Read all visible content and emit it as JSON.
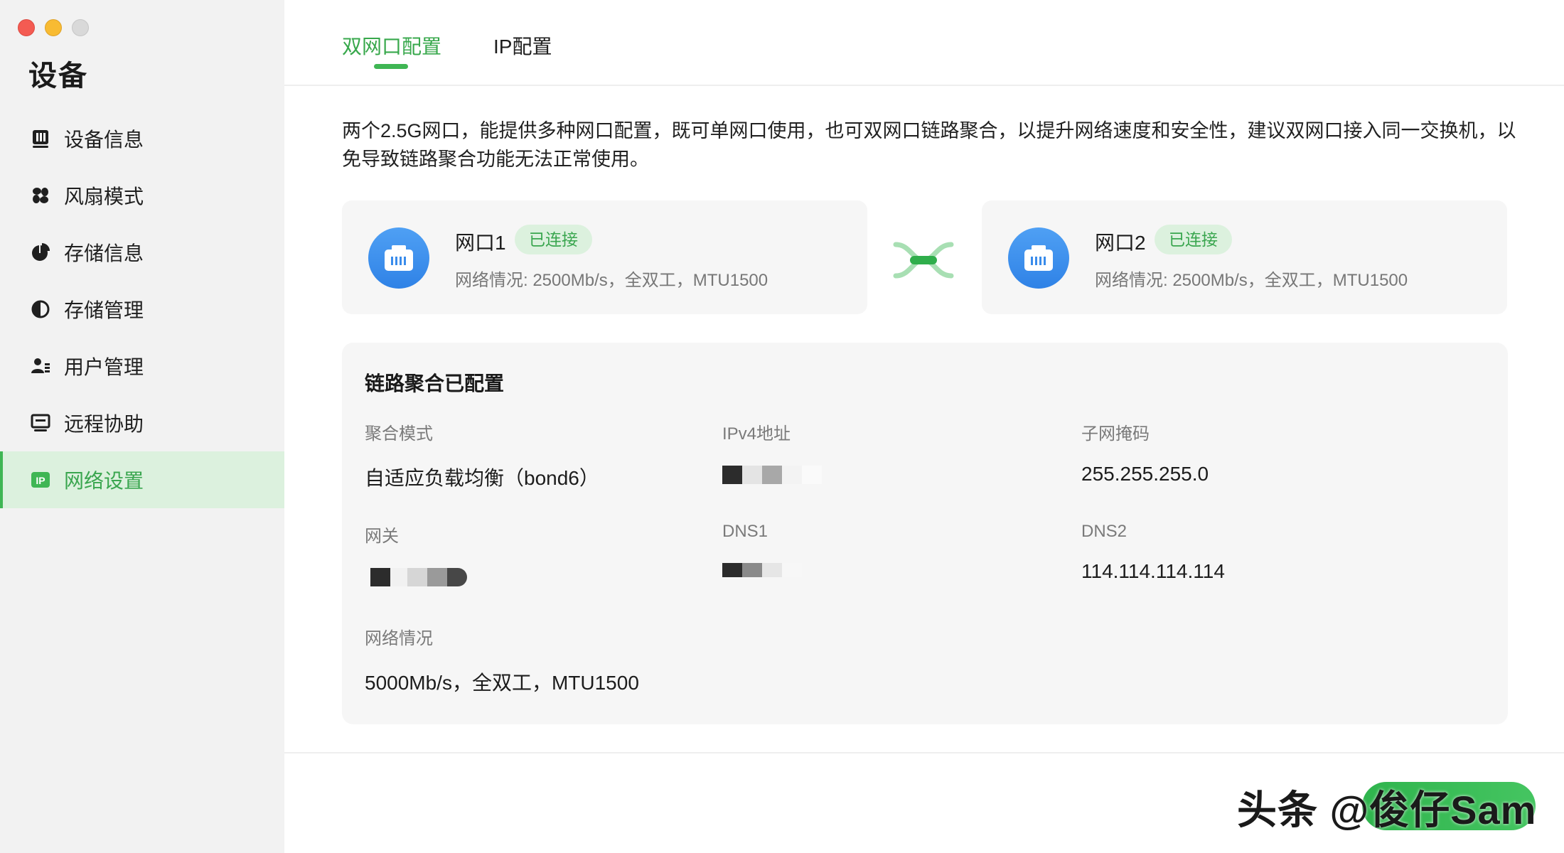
{
  "window": {
    "controls": [
      "close",
      "minimize",
      "zoom"
    ]
  },
  "sidebar": {
    "title": "设备",
    "items": [
      {
        "label": "设备信息",
        "icon": "device-info-icon"
      },
      {
        "label": "风扇模式",
        "icon": "fan-icon"
      },
      {
        "label": "存储信息",
        "icon": "storage-pie-icon"
      },
      {
        "label": "存储管理",
        "icon": "storage-manage-icon"
      },
      {
        "label": "用户管理",
        "icon": "users-icon"
      },
      {
        "label": "远程协助",
        "icon": "monitor-icon"
      },
      {
        "label": "网络设置",
        "icon": "ip-icon",
        "active": true
      }
    ]
  },
  "tabs": [
    {
      "label": "双网口配置",
      "active": true
    },
    {
      "label": "IP配置",
      "active": false
    }
  ],
  "intro": "两个2.5G网口，能提供多种网口配置，既可单网口使用，也可双网口链路聚合，以提升网络速度和安全性，建议双网口接入同一交换机，以免导致链路聚合功能无法正常使用。",
  "ports": [
    {
      "name": "网口1",
      "badge": "已连接",
      "status": "网络情况: 2500Mb/s，全双工，MTU1500"
    },
    {
      "name": "网口2",
      "badge": "已连接",
      "status": "网络情况: 2500Mb/s，全双工，MTU1500"
    }
  ],
  "aggregation": {
    "title": "链路聚合已配置",
    "fields": {
      "mode": {
        "label": "聚合模式",
        "value": "自适应负载均衡（bond6）"
      },
      "ipv4": {
        "label": "IPv4地址",
        "value": ""
      },
      "subnet": {
        "label": "子网掩码",
        "value": "255.255.255.0"
      },
      "gateway": {
        "label": "网关",
        "value": ""
      },
      "dns1": {
        "label": "DNS1",
        "value": ""
      },
      "dns2": {
        "label": "DNS2",
        "value": "114.114.114.114"
      },
      "network": {
        "label": "网络情况",
        "value": "5000Mb/s，全双工，MTU1500"
      }
    }
  },
  "footer": {
    "button_label": "",
    "watermark": "头条 @俊仔Sam"
  },
  "colors": {
    "accent": "#3fb654",
    "accent_bg": "#dcf1de",
    "port_icon": "#3a8ceb",
    "sidebar_bg": "#f2f2f2",
    "card_bg": "#f6f6f6"
  }
}
